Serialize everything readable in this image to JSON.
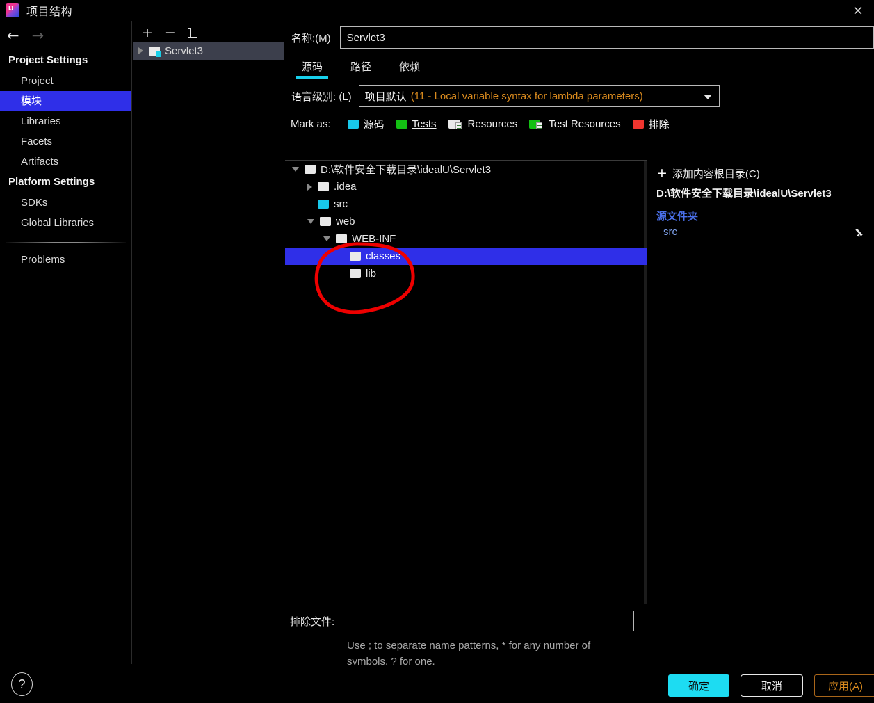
{
  "window": {
    "title": "项目结构",
    "logo_icon": "intellij-idea-logo",
    "close_icon": "×"
  },
  "sidebar": {
    "back_icon": "←",
    "forward_icon": "→",
    "groups": [
      {
        "header": "Project Settings",
        "items": [
          {
            "label": "Project",
            "selected": false
          },
          {
            "label": "模块",
            "selected": true
          },
          {
            "label": "Libraries",
            "selected": false
          },
          {
            "label": "Facets",
            "selected": false
          },
          {
            "label": "Artifacts",
            "selected": false
          }
        ]
      },
      {
        "header": "Platform Settings",
        "items": [
          {
            "label": "SDKs",
            "selected": false
          },
          {
            "label": "Global Libraries",
            "selected": false
          }
        ]
      }
    ],
    "problems_label": "Problems"
  },
  "module_list": {
    "toolbar": {
      "add_label": "+",
      "remove_label": "−",
      "copy_label": "copy-icon"
    },
    "rows": [
      {
        "label": "Servlet3",
        "selected": true,
        "expander": "right",
        "folder": "white-badge"
      }
    ]
  },
  "detail": {
    "name_label": "名称:(M)",
    "name_value": "Servlet3",
    "tabs": [
      {
        "label": "源码",
        "active": true
      },
      {
        "label": "路径",
        "active": false
      },
      {
        "label": "依赖",
        "active": false
      }
    ],
    "language_level": {
      "label": "语言级别: (L)",
      "main": "项目默认",
      "detail": "(11 - Local variable syntax for lambda parameters)",
      "caret_icon": "chevron-down-icon"
    },
    "mark_as": {
      "label": "Mark as:",
      "items": [
        {
          "label": "源码",
          "folder": "cyan",
          "mnemonic": ""
        },
        {
          "label": "Tests",
          "folder": "green",
          "mnemonic": "T"
        },
        {
          "label": "Resources",
          "folder": "white-res",
          "mnemonic": ""
        },
        {
          "label": "Test Resources",
          "folder": "test-res",
          "mnemonic": ""
        },
        {
          "label": "排除",
          "folder": "red",
          "mnemonic": ""
        }
      ]
    },
    "tree": [
      {
        "label": "D:\\软件安全下载目录\\idealU\\Servlet3",
        "depth": 0,
        "expander": "down",
        "folder": "white",
        "selected": false
      },
      {
        "label": ".idea",
        "depth": 1,
        "expander": "right",
        "folder": "white",
        "selected": false
      },
      {
        "label": "src",
        "depth": 1,
        "expander": "none",
        "folder": "cyan",
        "selected": false
      },
      {
        "label": "web",
        "depth": 1,
        "expander": "down",
        "folder": "white",
        "selected": false
      },
      {
        "label": "WEB-INF",
        "depth": 2,
        "expander": "down",
        "folder": "white",
        "selected": false
      },
      {
        "label": "classes",
        "depth": 3,
        "expander": "none",
        "folder": "white",
        "selected": true
      },
      {
        "label": "lib",
        "depth": 3,
        "expander": "none",
        "folder": "white",
        "selected": false
      }
    ],
    "exclude": {
      "label": "排除文件:",
      "value": "",
      "hint": "Use ; to separate name patterns, * for any number of symbols, ? for one."
    }
  },
  "content_root": {
    "add_label": "添加内容根目录(C)",
    "add_icon": "plus-icon",
    "path": "D:\\软件安全下载目录\\idealU\\Servlet3",
    "section_label": "源文件夹",
    "entries": [
      {
        "name": "src",
        "edit_icon": "pencil-icon"
      }
    ]
  },
  "footer": {
    "help_icon": "?",
    "ok_label": "确定",
    "cancel_label": "取消",
    "apply_label": "应用(A)"
  },
  "annotation": {
    "type": "hand-drawn-red-circle",
    "color": "#ee0000",
    "target": "classes and lib folders"
  },
  "colors": {
    "accent_blue": "#2F2FE8",
    "tab_underline": "#17d0ec",
    "ok_button": "#1ddcf2",
    "apply_text": "#d98a1e",
    "link_blue": "#4a6fe8",
    "annotation_red": "#ee0000"
  }
}
